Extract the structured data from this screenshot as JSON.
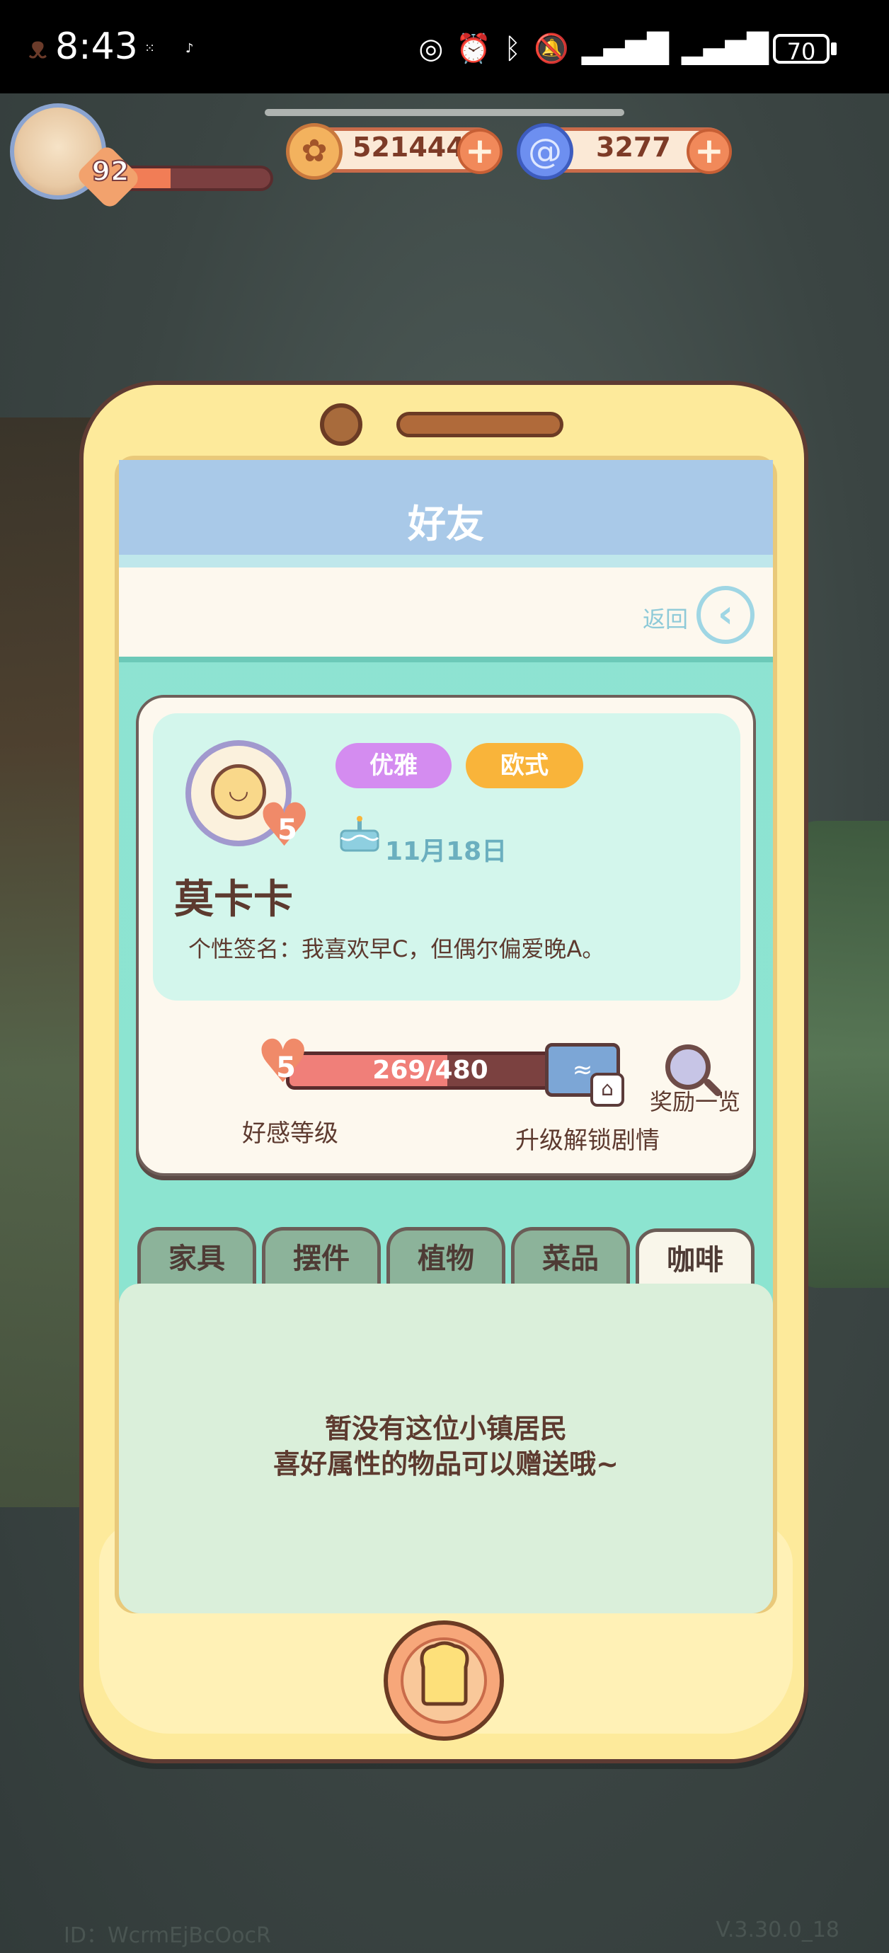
{
  "status_bar": {
    "time": "8:43",
    "battery": "70"
  },
  "player": {
    "level": "92",
    "xp_fraction": 0.38
  },
  "resources": {
    "coins": "521444",
    "gems": "3277"
  },
  "friend_panel": {
    "title": "好友",
    "back_label": "返回",
    "profile": {
      "tags": [
        "优雅",
        "欧式"
      ],
      "heart_level": "5",
      "birthday": "11月18日",
      "name": "莫卡卡",
      "signature": "个性签名：我喜欢早C，但偶尔偏爱晚A。"
    },
    "affinity": {
      "level": "5",
      "progress_text": "269/480",
      "progress_fraction": 0.56,
      "level_label": "好感等级",
      "unlock_label": "升级解锁剧情",
      "reward_label": "奖励一览"
    },
    "tabs": [
      "家具",
      "摆件",
      "植物",
      "菜品",
      "咖啡"
    ],
    "active_tab": 4,
    "empty_message": {
      "line1": "暂没有这位小镇居民",
      "line2": "喜好属性的物品可以赠送哦~"
    }
  },
  "footer": {
    "id_text": "ID：WcrmEjBcOocR",
    "version": "V.3.30.0_18"
  },
  "colors": {
    "header": "#a9c9e8",
    "screen_bg": "#8ee3d3",
    "tag_purple": "#d48cf0",
    "tag_orange": "#f9b43a",
    "text_brown": "#5d3a2f"
  }
}
